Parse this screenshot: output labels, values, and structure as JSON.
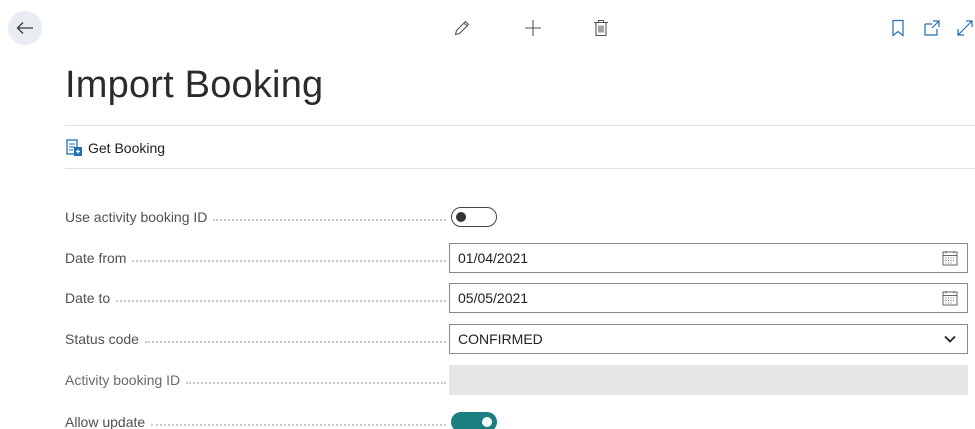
{
  "header": {
    "title": "Import Booking"
  },
  "actions": {
    "get_booking_label": "Get Booking"
  },
  "form": {
    "use_activity_booking_id": {
      "label": "Use activity booking ID",
      "value": false
    },
    "date_from": {
      "label": "Date from",
      "value": "01/04/2021"
    },
    "date_to": {
      "label": "Date to",
      "value": "05/05/2021"
    },
    "status_code": {
      "label": "Status code",
      "value": "CONFIRMED"
    },
    "activity_booking_id": {
      "label": "Activity booking ID",
      "value": ""
    },
    "allow_update": {
      "label": "Allow update",
      "value": true
    }
  },
  "icons": {
    "back": "arrow-left-icon",
    "edit": "pencil-icon",
    "new": "plus-icon",
    "delete": "trash-icon",
    "bookmark": "bookmark-icon",
    "open_new": "open-in-new-window-icon",
    "expand": "expand-icon",
    "calendar": "calendar-icon",
    "dropdown": "chevron-down-icon"
  },
  "colors": {
    "toggle_on": "#1a7f7e",
    "action_icon": "#1f6fb3",
    "back_button_bg": "#e9edf2"
  }
}
